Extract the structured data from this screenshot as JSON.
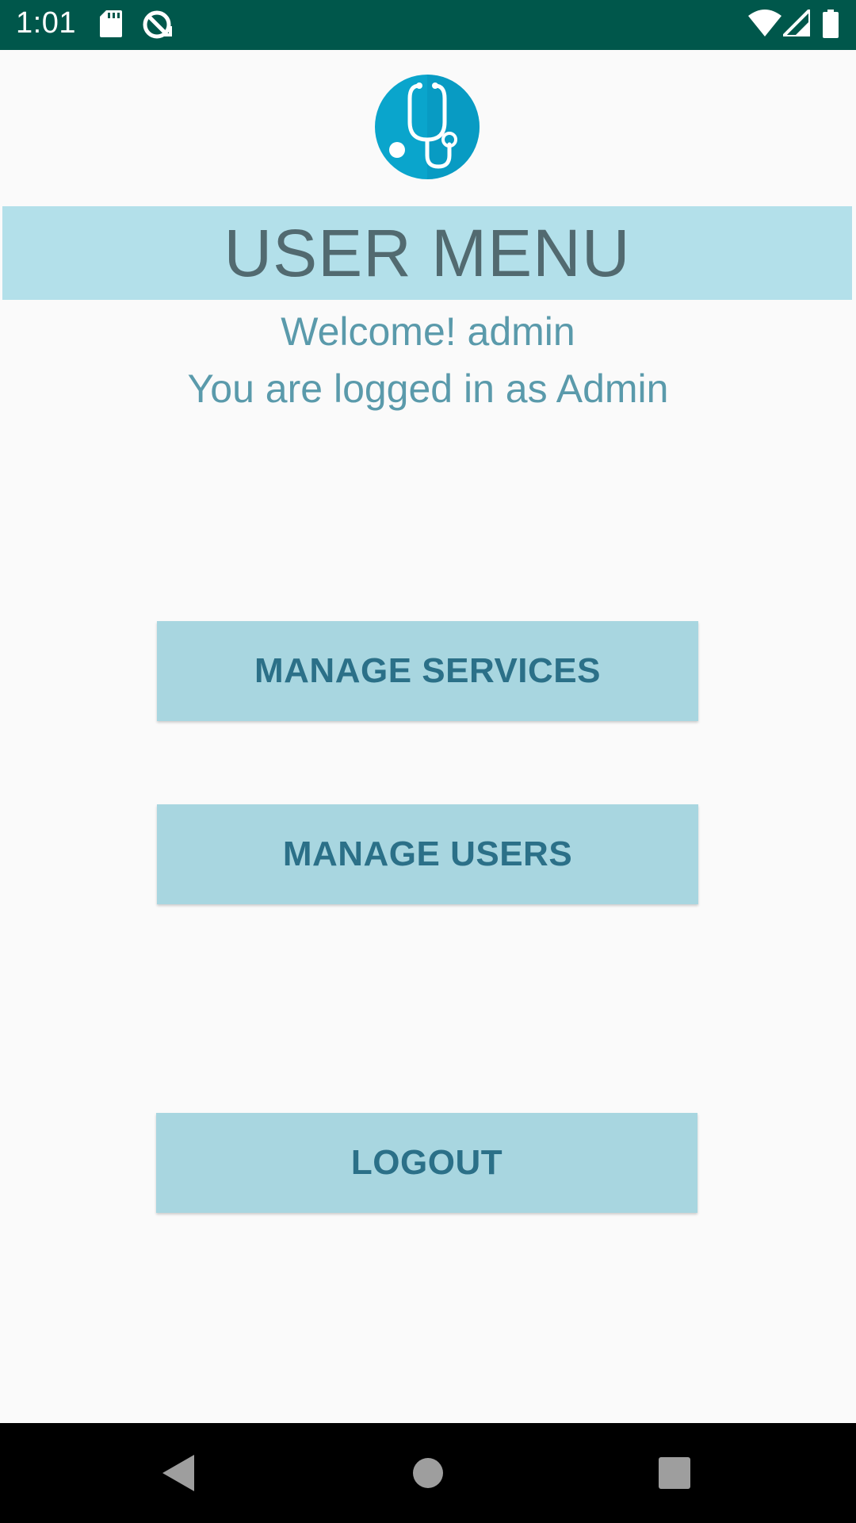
{
  "status_bar": {
    "time": "1:01",
    "icons": [
      "sd-card-icon",
      "data-saver-icon",
      "wifi-icon",
      "signal-icon",
      "battery-icon"
    ]
  },
  "app": {
    "logo_icon": "stethoscope-icon",
    "title": "USER MENU",
    "welcome_line": "Welcome! admin",
    "role_line": "You are logged in as Admin"
  },
  "buttons": {
    "manage_services": "MANAGE SERVICES",
    "manage_users": "MANAGE USERS",
    "logout": "LOGOUT"
  },
  "nav_bar": {
    "icons": [
      "back-icon",
      "home-icon",
      "recents-icon"
    ]
  },
  "colors": {
    "status_bar": "#00574b",
    "banner": "#b3e0ea",
    "button_bg": "#a8d6e0",
    "button_text": "#2b7088",
    "welcome_text": "#5a9aab",
    "title_text": "#526a70",
    "logo": "#0aa5cc"
  }
}
